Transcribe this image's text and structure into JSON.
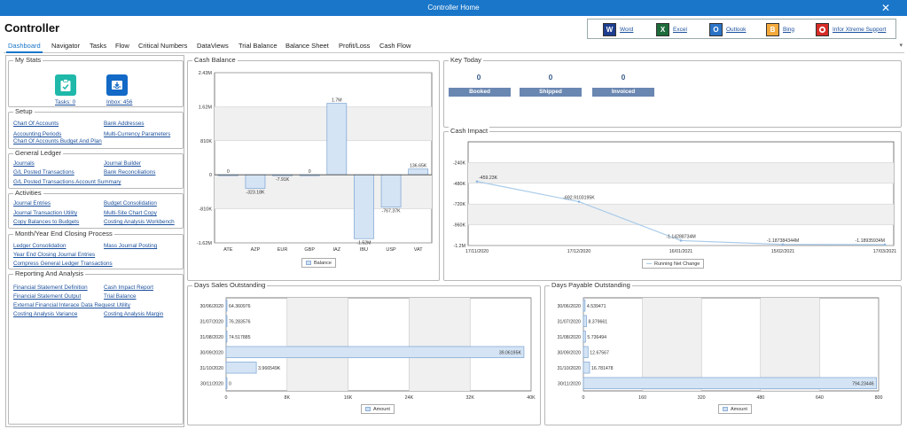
{
  "window": {
    "title": "Controller Home",
    "close": "✕"
  },
  "app": {
    "title": "Controller"
  },
  "launcher": [
    {
      "letter": "W",
      "label": "Word",
      "color": "#1d3d8f"
    },
    {
      "letter": "X",
      "label": "Excel",
      "color": "#1d6b3a"
    },
    {
      "letter": "O",
      "label": "Outlook",
      "color": "#2b73c6"
    },
    {
      "letter": "B",
      "label": "Bing",
      "color": "#f3a93c"
    },
    {
      "letter": "",
      "label": "Infor Xtreme Support",
      "color": "#d62c26"
    }
  ],
  "tabs": [
    "Dashboard",
    "Navigator",
    "Tasks",
    "Flow",
    "Critical Numbers",
    "DataViews",
    "Trial Balance",
    "Balance Sheet",
    "Profit/Loss",
    "Cash Flow"
  ],
  "active_tab": "Dashboard",
  "my_stats": {
    "title": "My Stats",
    "tasks_label": "Tasks: 0",
    "inbox_label": "Inbox: 456",
    "tasks_color": "#1fb8a9",
    "inbox_color": "#1269c6"
  },
  "setup": {
    "title": "Setup",
    "links": [
      "Chart Of Accounts",
      "Bank Addresses",
      "Accounting Periods",
      "Multi-Currency Parameters",
      "Chart Of Accounts Budget And Plan"
    ]
  },
  "general_ledger": {
    "title": "General Ledger",
    "links": [
      "Journals",
      "Journal Builder",
      "G/L Posted Transactions",
      "Bank Reconciliations",
      "G/L Posted Transactions Account Summary"
    ]
  },
  "activities": {
    "title": "Activities",
    "links": [
      "Journal Entries",
      "Budget Consolidation",
      "Journal Transaction Utility",
      "Multi-Site Chart Copy",
      "Copy Balances to Budgets",
      "Costing Analysis Workbench"
    ]
  },
  "month_year_end": {
    "title": "Month/Year End Closing Process",
    "links": [
      "Ledger Consolidation",
      "Mass Journal Posting",
      "Year End Closing Journal Entries",
      "Compress General Ledger Transactions"
    ]
  },
  "reporting": {
    "title": "Reporting And Analysis",
    "links": [
      "Financial Statement Definition",
      "Cash Impact Report",
      "Financial Statement Output",
      "Trial Balance",
      "External Financial Interace Data Request Utility",
      "Costing Analysis Variance",
      "Costing Analysis Margin"
    ]
  },
  "key_today": {
    "title": "Key Today",
    "items": [
      {
        "value": "0",
        "label": "Booked"
      },
      {
        "value": "0",
        "label": "Shipped"
      },
      {
        "value": "0",
        "label": "Invoiced"
      }
    ]
  },
  "cash_balance": {
    "title": "Cash Balance",
    "legend": "Balance",
    "chart_data": {
      "type": "bar",
      "categories": [
        "ATE",
        "AZP",
        "EUR",
        "GBP",
        "IAZ",
        "IBU",
        "USP",
        "VAT"
      ],
      "values": [
        0,
        -323180,
        -7910,
        0,
        1700000,
        -1520000,
        -767370,
        136650
      ],
      "data_labels": [
        "0",
        "-323.18K",
        "-7.91K",
        "0",
        "1.7M",
        "-1.52M",
        "-767.37K",
        "136.65K"
      ],
      "yticks": [
        "2.43M",
        "1.62M",
        "810K",
        "0",
        "-810K",
        "-1.62M"
      ],
      "ylim": [
        -1620000,
        2430000
      ]
    }
  },
  "cash_impact": {
    "title": "Cash Impact",
    "legend": "Running Net Change",
    "chart_data": {
      "type": "line",
      "x": [
        "17/11/2020",
        "17/12/2020",
        "16/01/2021",
        "15/02/2021",
        "17/03/2021"
      ],
      "values": [
        -459230,
        -692910,
        -1142887,
        -1187384,
        -1189359
      ],
      "data_labels": [
        "-459.23K",
        "-692.9103195K",
        "-1.14288734M",
        "-1.187384344M",
        "-1.18935934M"
      ],
      "yticks": [
        "-240K",
        "-480K",
        "-720K",
        "-960K",
        "-1.2M"
      ],
      "ylim": [
        -1200000,
        0
      ]
    }
  },
  "dso": {
    "title": "Days Sales Outstanding",
    "legend": "Amount",
    "chart_data": {
      "type": "bar",
      "orientation": "horizontal",
      "categories": [
        "30/06/2020",
        "31/07/2020",
        "31/08/2020",
        "30/09/2020",
        "31/10/2020",
        "30/11/2020"
      ],
      "values": [
        64.360976,
        76.283576,
        74.517885,
        39061.95,
        3966.549,
        0
      ],
      "data_labels": [
        "64.360976",
        "76.283576",
        "74.517885",
        "39.06195K",
        "3.966549K",
        "0"
      ],
      "xticks": [
        "0",
        "8K",
        "16K",
        "24K",
        "32K",
        "40K"
      ],
      "xlim": [
        0,
        40000
      ]
    }
  },
  "dpo": {
    "title": "Days Payable Outstanding",
    "legend": "Amount",
    "chart_data": {
      "type": "bar",
      "orientation": "horizontal",
      "categories": [
        "30/06/2020",
        "31/07/2020",
        "31/08/2020",
        "30/09/2020",
        "31/10/2020",
        "30/11/2020"
      ],
      "values": [
        4.539471,
        8.379661,
        5.736494,
        12.67567,
        16.781478,
        794.23446
      ],
      "data_labels": [
        "4.539471",
        "8.379661",
        "5.736494",
        "12.67567",
        "16.781478",
        "794.23446"
      ],
      "xticks": [
        "0",
        "160",
        "320",
        "480",
        "640",
        "800"
      ],
      "xlim": [
        0,
        800
      ]
    }
  },
  "colors": {
    "accent": "#1976c9",
    "bar_fill": "#d4e4f5",
    "bar_stroke": "#7aa3d1",
    "line": "#a9cbe9"
  }
}
